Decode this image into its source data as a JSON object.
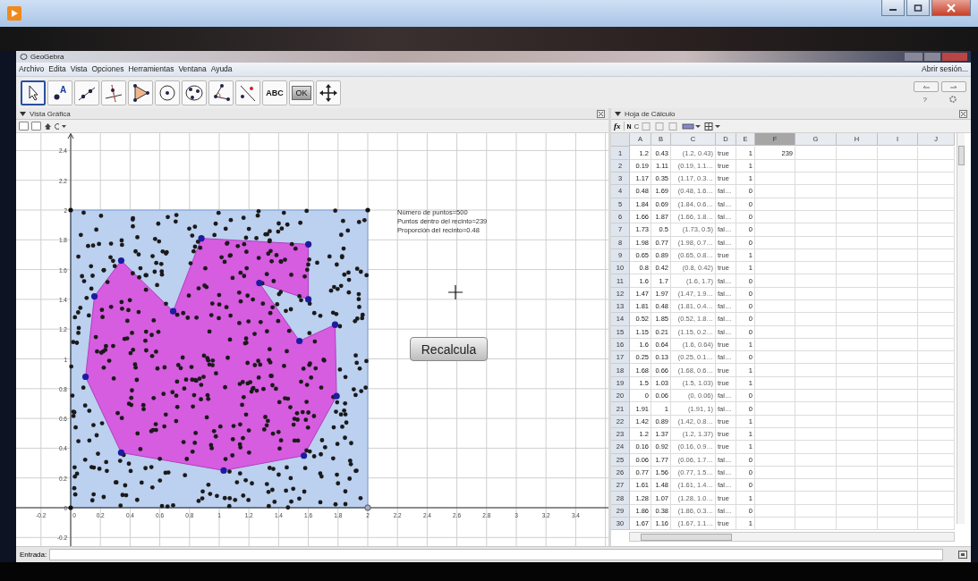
{
  "window": {
    "title": "GeoGebra",
    "login": "Abrir sesión...",
    "help": "?"
  },
  "menu": [
    "Archivo",
    "Edita",
    "Vista",
    "Opciones",
    "Herramientas",
    "Ventana",
    "Ayuda"
  ],
  "tools": [
    {
      "kind": "move",
      "selected": true
    },
    {
      "kind": "point",
      "label": "A",
      "selected": false
    },
    {
      "kind": "line",
      "selected": false
    },
    {
      "kind": "perpendicular",
      "selected": false
    },
    {
      "kind": "polygon",
      "selected": false
    },
    {
      "kind": "circle",
      "selected": false
    },
    {
      "kind": "conic",
      "selected": false
    },
    {
      "kind": "angle",
      "selected": false
    },
    {
      "kind": "reflect",
      "selected": false
    },
    {
      "kind": "text",
      "label": "ABC",
      "selected": false
    },
    {
      "kind": "button",
      "label": "OK",
      "selected": false
    },
    {
      "kind": "pan",
      "selected": false
    }
  ],
  "graphics_view": {
    "title": "Vista Gráfica",
    "x_labels": [
      "-0.2",
      "0",
      "0.2",
      "0.4",
      "0.6",
      "0.8",
      "1",
      "1.2",
      "1.4",
      "1.6",
      "1.8",
      "2",
      "2.2",
      "2.4",
      "2.6",
      "2.8",
      "3",
      "3.2",
      "3.4"
    ],
    "y_labels": [
      "2.4",
      "2.2",
      "2",
      "1.8",
      "1.6",
      "1.4",
      "1.2",
      "1",
      "0.8",
      "0.6",
      "0.4",
      "0.2",
      "0",
      "-0.2"
    ],
    "info": [
      "Número de puntos=500",
      "Puntos dentro del recinto=239",
      "Proporción del recinto=0.48"
    ],
    "button": "Recalcula"
  },
  "spreadsheet": {
    "title": "Hoja de Cálculo",
    "fx": "fx",
    "bold": "N",
    "italic": "C",
    "columns": [
      {
        "label": "A",
        "selected": false
      },
      {
        "label": "B",
        "selected": false
      },
      {
        "label": "C",
        "selected": false
      },
      {
        "label": "D",
        "selected": false
      },
      {
        "label": "E",
        "selected": false
      },
      {
        "label": "F",
        "selected": true
      },
      {
        "label": "G",
        "selected": false
      },
      {
        "label": "H",
        "selected": false
      },
      {
        "label": "I",
        "selected": false
      },
      {
        "label": "J",
        "selected": false
      }
    ],
    "rows": [
      {
        "n": "1",
        "cells": [
          "1.2",
          "0.43",
          "(1.2, 0.43)",
          "true",
          "1",
          "239"
        ]
      },
      {
        "n": "2",
        "cells": [
          "0.19",
          "1.11",
          "(0.19, 1.1…",
          "true",
          "1"
        ]
      },
      {
        "n": "3",
        "cells": [
          "1.17",
          "0.35",
          "(1.17, 0.3…",
          "true",
          "1"
        ]
      },
      {
        "n": "4",
        "cells": [
          "0.48",
          "1.69",
          "(0.48, 1.6…",
          "fal…",
          "0"
        ]
      },
      {
        "n": "5",
        "cells": [
          "1.84",
          "0.69",
          "(1.84, 0.6…",
          "fal…",
          "0"
        ]
      },
      {
        "n": "6",
        "cells": [
          "1.66",
          "1.87",
          "(1.66, 1.8…",
          "fal…",
          "0"
        ]
      },
      {
        "n": "7",
        "cells": [
          "1.73",
          "0.5",
          "(1.73, 0.5)",
          "fal…",
          "0"
        ]
      },
      {
        "n": "8",
        "cells": [
          "1.98",
          "0.77",
          "(1.98, 0.7…",
          "fal…",
          "0"
        ]
      },
      {
        "n": "9",
        "cells": [
          "0.65",
          "0.89",
          "(0.65, 0.8…",
          "true",
          "1"
        ]
      },
      {
        "n": "10",
        "cells": [
          "0.8",
          "0.42",
          "(0.8, 0.42)",
          "true",
          "1"
        ]
      },
      {
        "n": "11",
        "cells": [
          "1.6",
          "1.7",
          "(1.6, 1.7)",
          "fal…",
          "0"
        ]
      },
      {
        "n": "12",
        "cells": [
          "1.47",
          "1.97",
          "(1.47, 1.9…",
          "fal…",
          "0"
        ]
      },
      {
        "n": "13",
        "cells": [
          "1.81",
          "0.48",
          "(1.81, 0.4…",
          "fal…",
          "0"
        ]
      },
      {
        "n": "14",
        "cells": [
          "0.52",
          "1.85",
          "(0.52, 1.8…",
          "fal…",
          "0"
        ]
      },
      {
        "n": "15",
        "cells": [
          "1.15",
          "0.21",
          "(1.15, 0.2…",
          "fal…",
          "0"
        ]
      },
      {
        "n": "16",
        "cells": [
          "1.6",
          "0.64",
          "(1.6, 0.64)",
          "true",
          "1"
        ]
      },
      {
        "n": "17",
        "cells": [
          "0.25",
          "0.13",
          "(0.25, 0.1…",
          "fal…",
          "0"
        ]
      },
      {
        "n": "18",
        "cells": [
          "1.68",
          "0.66",
          "(1.68, 0.6…",
          "true",
          "1"
        ]
      },
      {
        "n": "19",
        "cells": [
          "1.5",
          "1.03",
          "(1.5, 1.03)",
          "true",
          "1"
        ]
      },
      {
        "n": "20",
        "cells": [
          "0",
          "0.06",
          "(0, 0.06)",
          "fal…",
          "0"
        ]
      },
      {
        "n": "21",
        "cells": [
          "1.91",
          "1",
          "(1.91, 1)",
          "fal…",
          "0"
        ]
      },
      {
        "n": "22",
        "cells": [
          "1.42",
          "0.89",
          "(1.42, 0.8…",
          "true",
          "1"
        ]
      },
      {
        "n": "23",
        "cells": [
          "1.2",
          "1.37",
          "(1.2, 1.37)",
          "true",
          "1"
        ]
      },
      {
        "n": "24",
        "cells": [
          "0.16",
          "0.92",
          "(0.16, 0.9…",
          "true",
          "1"
        ]
      },
      {
        "n": "25",
        "cells": [
          "0.06",
          "1.77",
          "(0.06, 1.7…",
          "fal…",
          "0"
        ]
      },
      {
        "n": "26",
        "cells": [
          "0.77",
          "1.56",
          "(0.77, 1.5…",
          "fal…",
          "0"
        ]
      },
      {
        "n": "27",
        "cells": [
          "1.61",
          "1.48",
          "(1.61, 1.4…",
          "fal…",
          "0"
        ]
      },
      {
        "n": "28",
        "cells": [
          "1.28",
          "1.07",
          "(1.28, 1.0…",
          "true",
          "1"
        ]
      },
      {
        "n": "29",
        "cells": [
          "1.86",
          "0.38",
          "(1.86, 0.3…",
          "fal…",
          "0"
        ]
      },
      {
        "n": "30",
        "cells": [
          "1.67",
          "1.16",
          "(1.67, 1.1…",
          "true",
          "1"
        ]
      }
    ]
  },
  "input_bar": {
    "label": "Entrada:"
  }
}
